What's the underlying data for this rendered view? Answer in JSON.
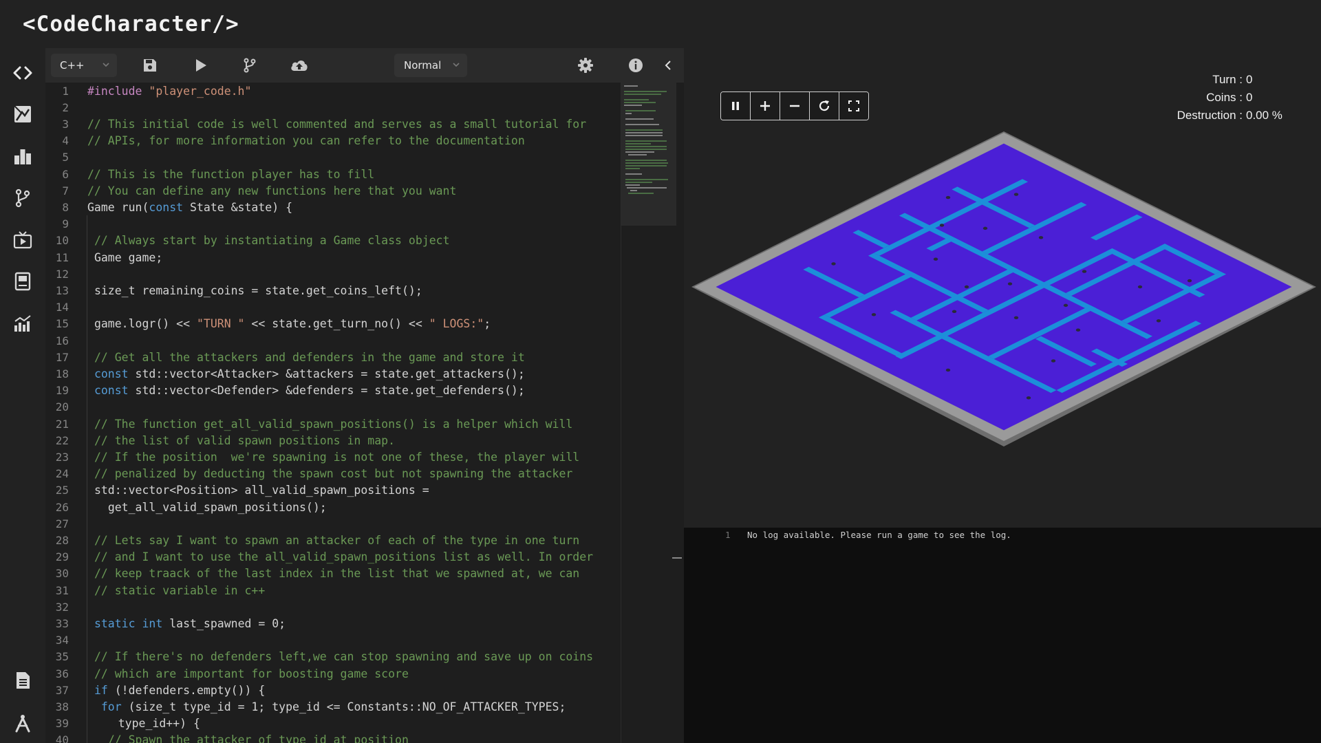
{
  "app": {
    "logo_text": "<CodeCharacter/>"
  },
  "sidebar": {
    "items": [
      {
        "name": "editor",
        "icon": "code-icon"
      },
      {
        "name": "map-designer",
        "icon": "map-icon"
      },
      {
        "name": "leaderboard",
        "icon": "leaderboard-icon"
      },
      {
        "name": "history",
        "icon": "git-branch-icon"
      },
      {
        "name": "battle-tv",
        "icon": "tv-icon"
      },
      {
        "name": "dashboard",
        "icon": "book-icon"
      },
      {
        "name": "statistics",
        "icon": "chart-icon"
      },
      {
        "name": "documentation",
        "icon": "document-icon"
      },
      {
        "name": "tutorials",
        "icon": "compass-icon"
      }
    ]
  },
  "toolbar": {
    "language": "C++",
    "mode": "Normal",
    "icons": [
      "save-icon",
      "play-icon",
      "commit-icon",
      "upload-icon",
      "gear-icon",
      "info-icon"
    ]
  },
  "editor": {
    "lines": [
      {
        "n": "1",
        "indent": 0,
        "tokens": [
          [
            "pp",
            "#include"
          ],
          [
            "",
            " "
          ],
          [
            "str",
            "\"player_code.h\""
          ]
        ]
      },
      {
        "n": "2",
        "indent": 0,
        "tokens": []
      },
      {
        "n": "3",
        "indent": 0,
        "tokens": [
          [
            "cm",
            "// This initial code is well commented and serves as a small tutorial for"
          ]
        ]
      },
      {
        "n": "4",
        "indent": 0,
        "tokens": [
          [
            "cm",
            "// APIs, for more information you can refer to the documentation"
          ]
        ]
      },
      {
        "n": "5",
        "indent": 0,
        "tokens": []
      },
      {
        "n": "6",
        "indent": 0,
        "tokens": [
          [
            "cm",
            "// This is the function player has to fill"
          ]
        ]
      },
      {
        "n": "7",
        "indent": 0,
        "tokens": [
          [
            "cm",
            "// You can define any new functions here that you want"
          ]
        ]
      },
      {
        "n": "8",
        "indent": 0,
        "tokens": [
          [
            "",
            "Game run("
          ],
          [
            "kw",
            "const"
          ],
          [
            "",
            " State &state) {"
          ]
        ]
      },
      {
        "n": "9",
        "indent": 0,
        "tokens": []
      },
      {
        "n": "10",
        "indent": 2,
        "tokens": [
          [
            "cm",
            "// Always start by instantiating a Game class object"
          ]
        ]
      },
      {
        "n": "11",
        "indent": 2,
        "tokens": [
          [
            "",
            "Game game;"
          ]
        ]
      },
      {
        "n": "12",
        "indent": 0,
        "tokens": []
      },
      {
        "n": "13",
        "indent": 2,
        "tokens": [
          [
            "",
            "size_t remaining_coins = state.get_coins_left();"
          ]
        ]
      },
      {
        "n": "14",
        "indent": 0,
        "tokens": []
      },
      {
        "n": "15",
        "indent": 2,
        "tokens": [
          [
            "",
            "game.logr() << "
          ],
          [
            "str",
            "\"TURN \""
          ],
          [
            "",
            " << state.get_turn_no() << "
          ],
          [
            "str",
            "\" LOGS:\""
          ],
          [
            "",
            ";"
          ]
        ]
      },
      {
        "n": "16",
        "indent": 0,
        "tokens": []
      },
      {
        "n": "17",
        "indent": 2,
        "tokens": [
          [
            "cm",
            "// Get all the attackers and defenders in the game and store it"
          ]
        ]
      },
      {
        "n": "18",
        "indent": 2,
        "tokens": [
          [
            "kw",
            "const"
          ],
          [
            "",
            " std::vector<Attacker> &attackers = state.get_attackers();"
          ]
        ]
      },
      {
        "n": "19",
        "indent": 2,
        "tokens": [
          [
            "kw",
            "const"
          ],
          [
            "",
            " std::vector<Defender> &defenders = state.get_defenders();"
          ]
        ]
      },
      {
        "n": "20",
        "indent": 0,
        "tokens": []
      },
      {
        "n": "21",
        "indent": 2,
        "tokens": [
          [
            "cm",
            "// The function get_all_valid_spawn_positions() is a helper which will"
          ]
        ]
      },
      {
        "n": "22",
        "indent": 2,
        "tokens": [
          [
            "cm",
            "// the list of valid spawn positions in map."
          ]
        ]
      },
      {
        "n": "23",
        "indent": 2,
        "tokens": [
          [
            "cm",
            "// If the position  we're spawning is not one of these, the player will"
          ]
        ]
      },
      {
        "n": "24",
        "indent": 2,
        "tokens": [
          [
            "cm",
            "// penalized by deducting the spawn cost but not spawning the attacker"
          ]
        ]
      },
      {
        "n": "25",
        "indent": 2,
        "tokens": [
          [
            "",
            "std::vector<Position> all_valid_spawn_positions ="
          ]
        ]
      },
      {
        "n": "26",
        "indent": 6,
        "tokens": [
          [
            "",
            "get_all_valid_spawn_positions();"
          ]
        ]
      },
      {
        "n": "27",
        "indent": 0,
        "tokens": []
      },
      {
        "n": "28",
        "indent": 2,
        "tokens": [
          [
            "cm",
            "// Lets say I want to spawn an attacker of each of the type in one turn"
          ]
        ]
      },
      {
        "n": "29",
        "indent": 2,
        "tokens": [
          [
            "cm",
            "// and I want to use the all_valid_spawn_positions list as well. In order"
          ]
        ]
      },
      {
        "n": "30",
        "indent": 2,
        "tokens": [
          [
            "cm",
            "// keep traack of the last index in the list that we spawned at, we can"
          ]
        ]
      },
      {
        "n": "31",
        "indent": 2,
        "tokens": [
          [
            "cm",
            "// static variable in c++"
          ]
        ]
      },
      {
        "n": "32",
        "indent": 0,
        "tokens": []
      },
      {
        "n": "33",
        "indent": 2,
        "tokens": [
          [
            "kw",
            "static"
          ],
          [
            "",
            " "
          ],
          [
            "kw",
            "int"
          ],
          [
            "",
            " last_spawned = 0;"
          ]
        ]
      },
      {
        "n": "34",
        "indent": 0,
        "tokens": []
      },
      {
        "n": "35",
        "indent": 2,
        "tokens": [
          [
            "cm",
            "// If there's no defenders left,we can stop spawning and save up on coins"
          ]
        ]
      },
      {
        "n": "36",
        "indent": 2,
        "tokens": [
          [
            "cm",
            "// which are important for boosting game score"
          ]
        ]
      },
      {
        "n": "37",
        "indent": 2,
        "tokens": [
          [
            "kw",
            "if"
          ],
          [
            "",
            " (!defenders.empty()) {"
          ]
        ]
      },
      {
        "n": "38",
        "indent": 4,
        "tokens": [
          [
            "kw",
            "for"
          ],
          [
            "",
            " (size_t type_id = 1; type_id <= Constants::NO_OF_ATTACKER_TYPES;"
          ]
        ]
      },
      {
        "n": "39",
        "indent": 9,
        "tokens": [
          [
            "",
            "type_id++) {"
          ]
        ]
      },
      {
        "n": "40",
        "indent": 6,
        "tokens": [
          [
            "cm",
            "// Spawn the attacker of type_id at position"
          ]
        ]
      }
    ]
  },
  "game": {
    "controls": [
      "pause-icon",
      "zoom-in-icon",
      "zoom-out-icon",
      "reset-icon",
      "fullscreen-icon"
    ],
    "stats": {
      "turn_label": "Turn :",
      "turn_value": "0",
      "coins_label": "Coins :",
      "coins_value": "0",
      "destruction_label": "Destruction :",
      "destruction_value": "0.00 %"
    },
    "colors": {
      "floor": "#4b1fd6",
      "path": "#1c8fd9",
      "border": "#9a9a9a"
    }
  },
  "log": {
    "lines": [
      {
        "n": "1",
        "text": "No log available. Please run a game to see the log."
      }
    ]
  }
}
